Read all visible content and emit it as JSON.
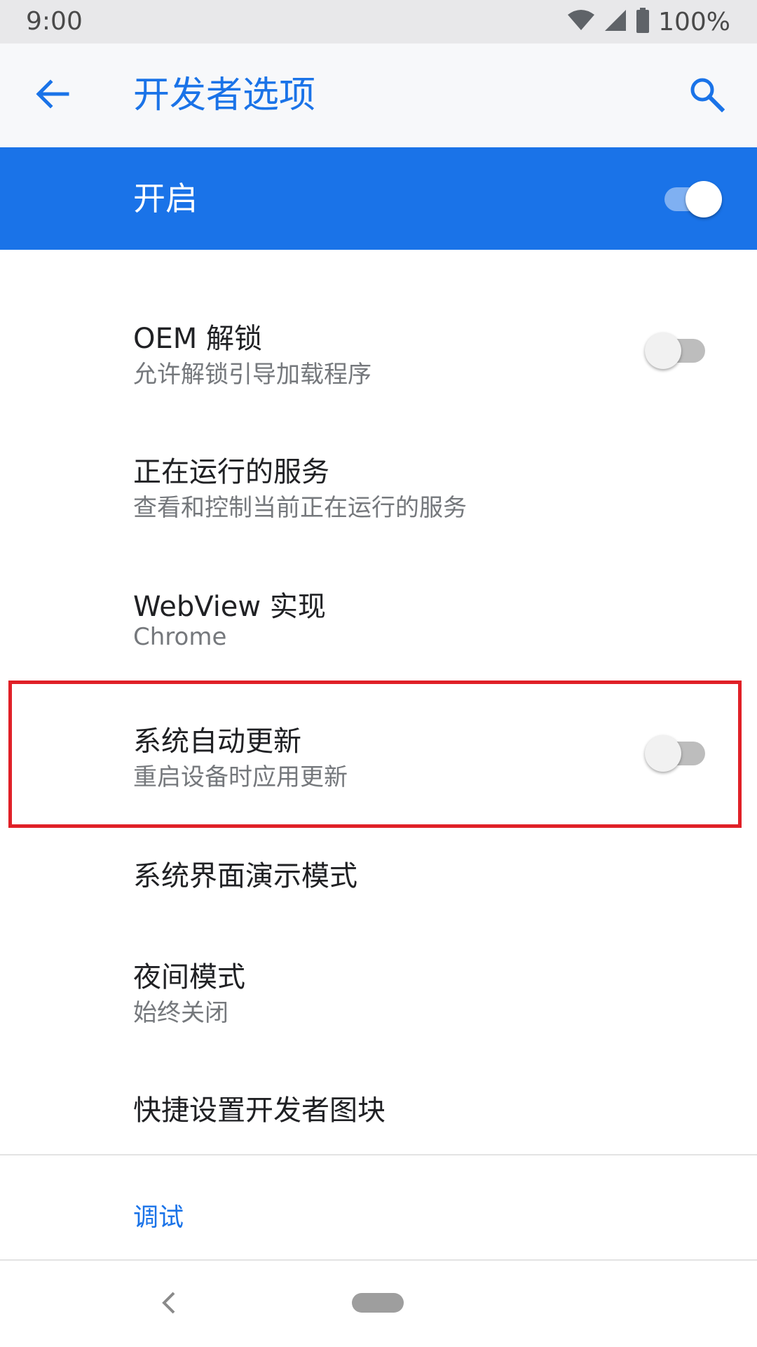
{
  "status_bar": {
    "time": "9:00",
    "battery_text": "100%"
  },
  "app_bar": {
    "title": "开发者选项"
  },
  "master": {
    "label": "开启",
    "on": true
  },
  "items": [
    {
      "title": "OEM 解锁",
      "subtitle": "允许解锁引导加载程序",
      "switch": "off"
    },
    {
      "title": "正在运行的服务",
      "subtitle": "查看和控制当前正在运行的服务"
    },
    {
      "title": "WebView 实现",
      "subtitle": "Chrome"
    },
    {
      "title": "系统自动更新",
      "subtitle": "重启设备时应用更新",
      "switch": "off"
    },
    {
      "title": "系统界面演示模式"
    },
    {
      "title": "夜间模式",
      "subtitle": "始终关闭"
    },
    {
      "title": "快捷设置开发者图块"
    }
  ],
  "section": {
    "header": "调试"
  },
  "colors": {
    "accent": "#1a73e8",
    "highlight": "#e02027"
  },
  "icons": {
    "back": "arrow-left-icon",
    "search": "search-icon",
    "wifi": "wifi-icon",
    "signal": "cell-signal-icon",
    "battery": "battery-icon"
  }
}
